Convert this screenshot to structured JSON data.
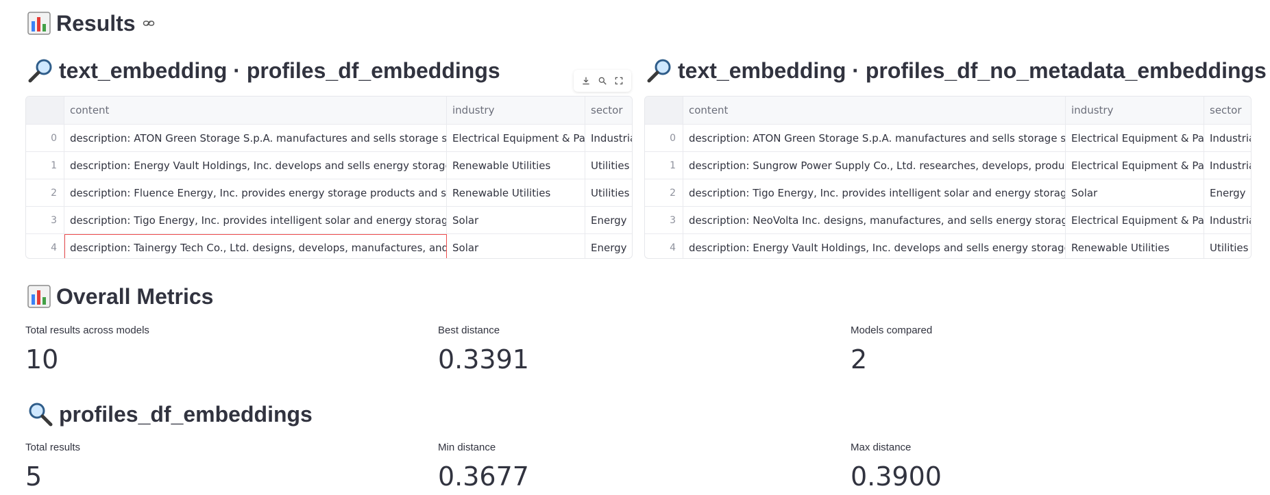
{
  "results_header": {
    "title": "Results"
  },
  "left_panel": {
    "title": "text_embedding · profiles_df_embeddings",
    "columns": [
      "",
      "content",
      "industry",
      "sector"
    ],
    "rows": [
      {
        "idx": "0",
        "content": "description: ATON Green Storage S.p.A. manufactures and sells storage systems for pl",
        "industry": "Electrical Equipment & Parts",
        "sector": "Industria"
      },
      {
        "idx": "1",
        "content": "description: Energy Vault Holdings, Inc. develops and sells energy storage solutions. T",
        "industry": "Renewable Utilities",
        "sector": "Utilities"
      },
      {
        "idx": "2",
        "content": "description: Fluence Energy, Inc. provides energy storage products and services, and",
        "industry": "Renewable Utilities",
        "sector": "Utilities"
      },
      {
        "idx": "3",
        "content": "description: Tigo Energy, Inc. provides intelligent solar and energy storage solutions.",
        "industry": "Solar",
        "sector": "Energy"
      },
      {
        "idx": "4",
        "content": "description: Tainergy Tech Co., Ltd. designs, develops, manufactures, and markets so",
        "industry": "Solar",
        "sector": "Energy"
      }
    ]
  },
  "right_panel": {
    "title": "text_embedding · profiles_df_no_metadata_embeddings",
    "columns": [
      "",
      "content",
      "industry",
      "sector"
    ],
    "rows": [
      {
        "idx": "0",
        "content": "description: ATON Green Storage S.p.A. manufactures and sells storage systems for pl",
        "industry": "Electrical Equipment & Parts",
        "sector": "Industria"
      },
      {
        "idx": "1",
        "content": "description: Sungrow Power Supply Co., Ltd. researches, develops, produces, sells, ar",
        "industry": "Electrical Equipment & Parts",
        "sector": "Industria"
      },
      {
        "idx": "2",
        "content": "description: Tigo Energy, Inc. provides intelligent solar and energy storage solutions.",
        "industry": "Solar",
        "sector": "Energy"
      },
      {
        "idx": "3",
        "content": "description: NeoVolta Inc. designs, manufactures, and sells energy storage systems in",
        "industry": "Electrical Equipment & Parts",
        "sector": "Industria"
      },
      {
        "idx": "4",
        "content": "description: Energy Vault Holdings, Inc. develops and sells energy storage solutions. T",
        "industry": "Renewable Utilities",
        "sector": "Utilities"
      }
    ]
  },
  "overall_metrics": {
    "title": "Overall Metrics",
    "metrics": [
      {
        "label": "Total results across models",
        "value": "10"
      },
      {
        "label": "Best distance",
        "value": "0.3391"
      },
      {
        "label": "Models compared",
        "value": "2"
      }
    ]
  },
  "profiles_section": {
    "title": "profiles_df_embeddings",
    "metrics": [
      {
        "label": "Total results",
        "value": "5"
      },
      {
        "label": "Min distance",
        "value": "0.3677"
      },
      {
        "label": "Max distance",
        "value": "0.3900"
      }
    ]
  },
  "colors": {
    "text": "#31333f",
    "selection": "#ef4d4d",
    "header_bg": "#f7f8fa",
    "border": "#e6e7eb"
  },
  "icons": [
    "bar-chart-icon",
    "link-icon",
    "magnifier-icon",
    "download-icon",
    "search-icon",
    "fullscreen-icon"
  ]
}
